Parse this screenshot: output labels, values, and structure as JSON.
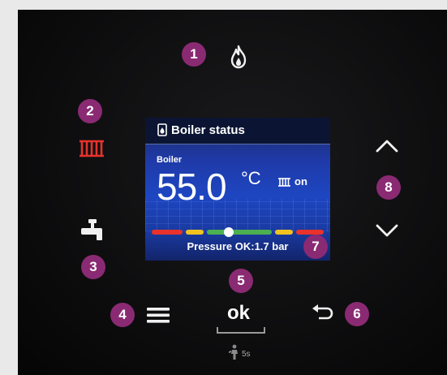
{
  "badges": [
    "1",
    "2",
    "3",
    "4",
    "5",
    "6",
    "7",
    "8"
  ],
  "screen": {
    "title": "Boiler status",
    "subtitle": "Boiler",
    "temperature": "55.0",
    "unit": "°C",
    "heating_state": "on",
    "pressure_text": "Pressure OK:1.7 bar"
  },
  "buttons": {
    "ok_label": "ok",
    "hold_duration": "5s"
  },
  "icons": {
    "flame": "flame-icon",
    "radiator": "radiator-icon",
    "tap": "hot-water-tap-icon",
    "menu": "menu-icon",
    "back": "back-arrow-icon",
    "up": "chevron-up-icon",
    "down": "chevron-down-icon",
    "reset": "reset-person-icon"
  },
  "colors": {
    "badge": "#8a2a73",
    "radiator_active": "#e8322b",
    "screen_blue": "#1e46c2",
    "pressure_ok": "#4caf50"
  },
  "pressure_bar_level": 0.45
}
